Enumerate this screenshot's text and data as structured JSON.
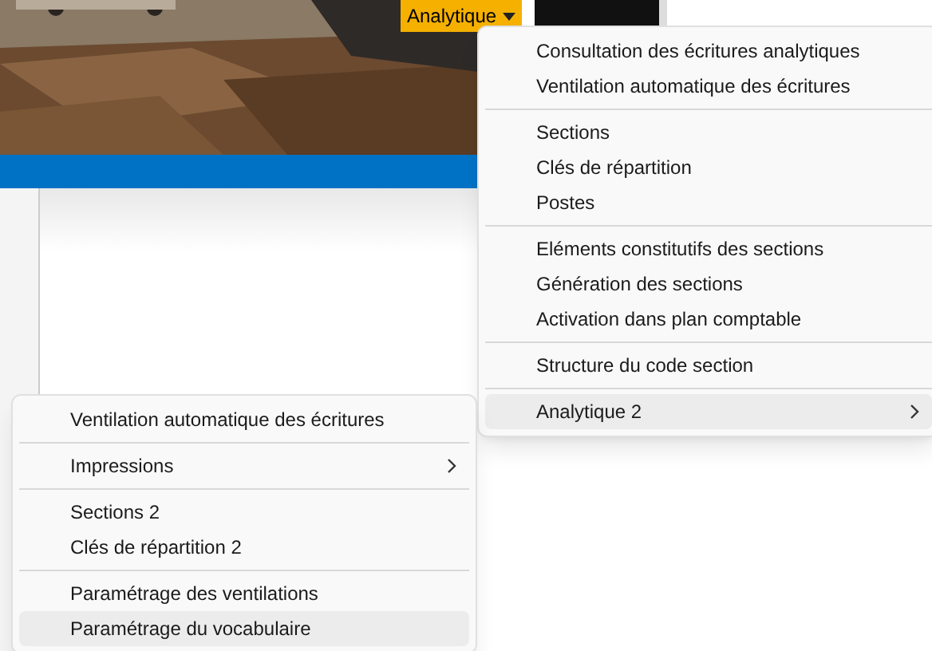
{
  "menu_button": {
    "label": "Analytique",
    "expanded": true
  },
  "menus": [
    {
      "groups": [
        {
          "items": [
            {
              "label": "Consultation des écritures analytiques",
              "submenu": false,
              "selected": false
            },
            {
              "label": "Ventilation automatique des écritures",
              "submenu": false,
              "selected": false
            }
          ]
        },
        {
          "items": [
            {
              "label": "Sections",
              "submenu": false,
              "selected": false
            },
            {
              "label": "Clés de répartition",
              "submenu": false,
              "selected": false
            },
            {
              "label": "Postes",
              "submenu": false,
              "selected": false
            }
          ]
        },
        {
          "items": [
            {
              "label": "Eléments constitutifs des sections",
              "submenu": false,
              "selected": false
            },
            {
              "label": "Génération des sections",
              "submenu": false,
              "selected": false
            },
            {
              "label": "Activation dans plan comptable",
              "submenu": false,
              "selected": false
            }
          ]
        },
        {
          "items": [
            {
              "label": "Structure du code section",
              "submenu": false,
              "selected": false
            }
          ]
        },
        {
          "items": [
            {
              "label": "Analytique 2",
              "submenu": true,
              "selected": true
            }
          ]
        }
      ]
    },
    {
      "groups": [
        {
          "items": [
            {
              "label": "Ventilation automatique des écritures",
              "submenu": false,
              "selected": false
            }
          ]
        },
        {
          "items": [
            {
              "label": "Impressions",
              "submenu": true,
              "selected": false
            }
          ]
        },
        {
          "items": [
            {
              "label": "Sections 2",
              "submenu": false,
              "selected": false
            },
            {
              "label": "Clés de répartition 2",
              "submenu": false,
              "selected": false
            }
          ]
        },
        {
          "items": [
            {
              "label": "Paramétrage des ventilations",
              "submenu": false,
              "selected": false
            },
            {
              "label": "Paramétrage du vocabulaire",
              "submenu": false,
              "selected": true
            }
          ]
        }
      ]
    }
  ]
}
